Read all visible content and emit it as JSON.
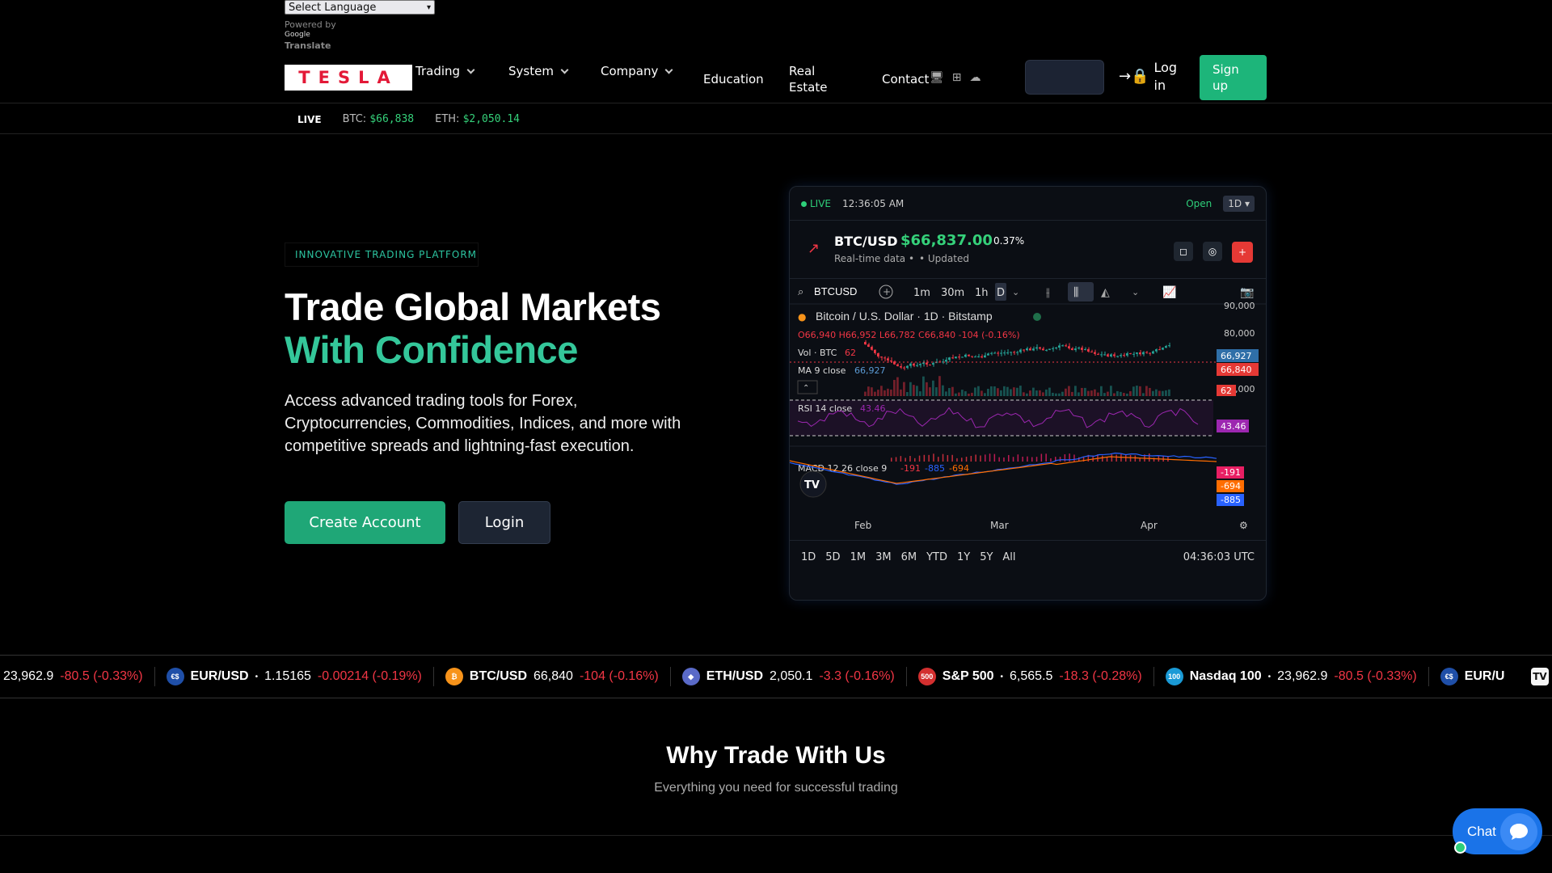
{
  "language": {
    "select_label": "Select Language",
    "powered_by": "Powered by",
    "google": "Google",
    "translate": "Translate"
  },
  "nav": {
    "logo": "TESLA",
    "items": [
      {
        "label": "Trading"
      },
      {
        "label": "System"
      },
      {
        "label": "Company"
      },
      {
        "label": "Education"
      },
      {
        "label": "Real Estate"
      },
      {
        "label": "Contact"
      }
    ],
    "login": "Log in",
    "signup": "Sign up"
  },
  "ticker_top": {
    "live": "LIVE",
    "btc_label": "BTC:",
    "btc_price": "$66,838",
    "eth_label": "ETH:",
    "eth_price": "$2,050.14"
  },
  "hero": {
    "badge": "INNOVATIVE TRADING PLATFORM",
    "title_line1": "Trade Global Markets",
    "title_line2": "With Confidence",
    "description": "Access advanced trading tools for Forex, Cryptocurrencies, Commodities, Indices, and more with competitive spreads and lightning-fast execution.",
    "create_button": "Create Account",
    "login_button": "Login"
  },
  "widget": {
    "live": "LIVE",
    "time": "12:36:05 AM",
    "status": "Open",
    "interval": "1D",
    "symbol": "BTC/USD",
    "price": "$66,837.00",
    "change": "0.37%",
    "sub1": "Real-time data •",
    "sub2": "• Updated",
    "search_symbol": "BTCUSD",
    "intervals": [
      "1m",
      "30m",
      "1h",
      "D"
    ],
    "chart_title": "Bitcoin / U.S. Dollar · 1D · Bitstamp",
    "ohlc": "O66,940 H66,952 L66,782 C66,840 -104 (-0.16%)",
    "vol": "Vol · BTC",
    "vol_val": "62",
    "ma": "MA 9 close",
    "ma_val": "66,927",
    "rsi": "RSI 14 close",
    "rsi_val": "43.46",
    "macd": "MACD 12 26 close 9",
    "macd_vals": [
      "-191",
      "-885",
      "-694"
    ],
    "y_ticks": [
      "90,000",
      "80,000",
      "60,000"
    ],
    "price_tags": [
      "66,927",
      "66,840",
      "62"
    ],
    "rsi_tag": "43.46",
    "macd_tags": [
      "-191",
      "-694",
      "-885"
    ],
    "months": [
      "Feb",
      "Mar",
      "Apr"
    ],
    "ranges": [
      "1D",
      "5D",
      "1M",
      "3M",
      "6M",
      "YTD",
      "1Y",
      "5Y",
      "All"
    ],
    "utc": "04:36:03 UTC",
    "colors": {
      "up": "#26a69a",
      "down": "#f23645",
      "rsi": "#9c27b0",
      "macd": "#2962ff",
      "signal": "#ff6d00"
    }
  },
  "ticker_bottom": [
    {
      "sym": "",
      "price": "23,962.9",
      "change": "-80.5 (-0.33%)",
      "icon": "",
      "color": ""
    },
    {
      "sym": "EUR/USD",
      "dot": "•",
      "price": "1.15165",
      "change": "-0.00214 (-0.19%)",
      "icon": "€$",
      "color": "#1f4fa8"
    },
    {
      "sym": "BTC/USD",
      "price": "66,840",
      "change": "-104 (-0.16%)",
      "icon": "₿",
      "color": "#f7931a"
    },
    {
      "sym": "ETH/USD",
      "price": "2,050.1",
      "change": "-3.3 (-0.16%)",
      "icon": "◆",
      "color": "#5a6ac8"
    },
    {
      "sym": "S&P 500",
      "dot": "•",
      "price": "6,565.5",
      "change": "-18.3 (-0.28%)",
      "icon": "500",
      "color": "#d32f2f"
    },
    {
      "sym": "Nasdaq 100",
      "dot": "•",
      "price": "23,962.9",
      "change": "-80.5 (-0.33%)",
      "icon": "100",
      "color": "#1a9ad6"
    },
    {
      "sym": "EUR/U",
      "price": "",
      "change": "",
      "icon": "€$",
      "color": "#1f4fa8"
    }
  ],
  "why": {
    "title": "Why Trade With Us",
    "subtitle": "Everything you need for successful trading"
  },
  "chat": {
    "label": "Chat"
  }
}
